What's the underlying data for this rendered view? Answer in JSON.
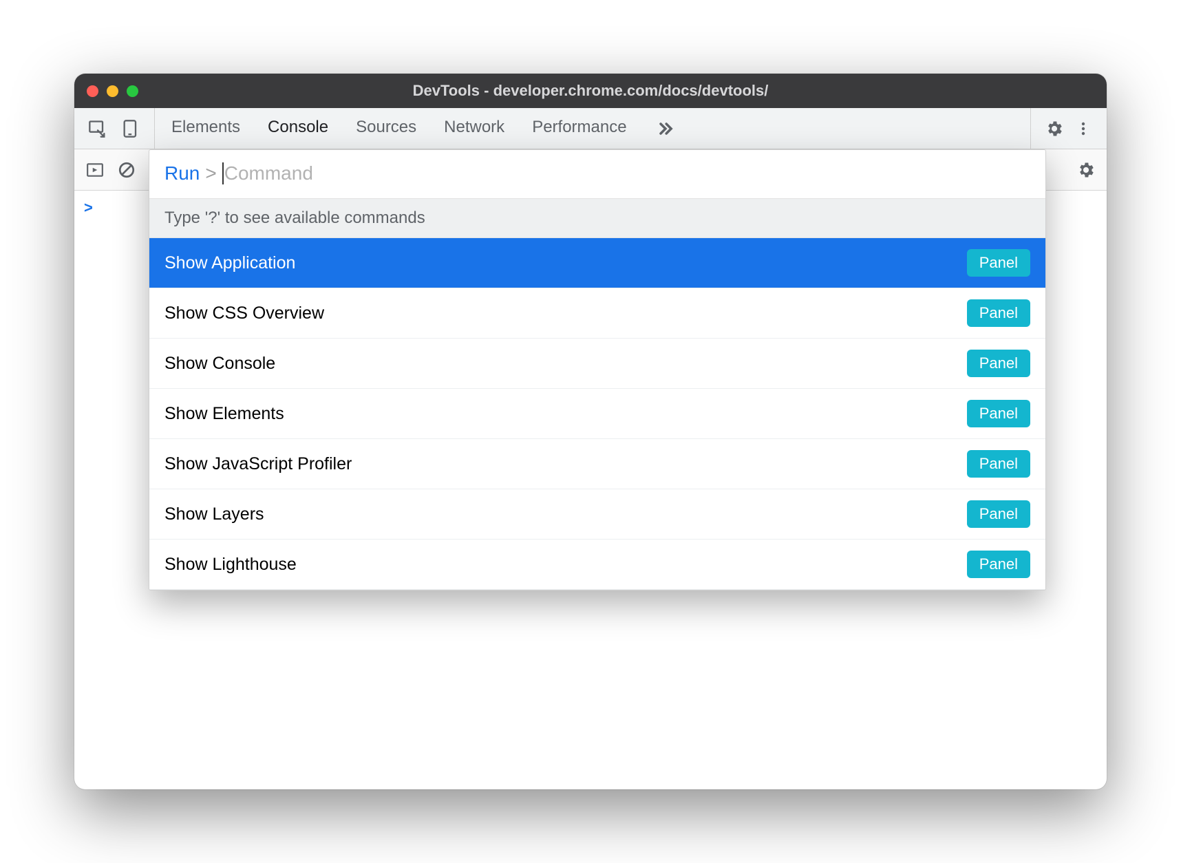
{
  "window": {
    "title": "DevTools - developer.chrome.com/docs/devtools/"
  },
  "tabs": {
    "items": [
      {
        "label": "Elements",
        "active": false
      },
      {
        "label": "Console",
        "active": true
      },
      {
        "label": "Sources",
        "active": false
      },
      {
        "label": "Network",
        "active": false
      },
      {
        "label": "Performance",
        "active": false
      }
    ],
    "overflow_icon": "chevrons-right"
  },
  "command_menu": {
    "prefix": "Run",
    "arrow": ">",
    "placeholder": "Command",
    "hint": "Type '?' to see available commands",
    "items": [
      {
        "label": "Show Application",
        "badge": "Panel",
        "selected": true
      },
      {
        "label": "Show CSS Overview",
        "badge": "Panel",
        "selected": false
      },
      {
        "label": "Show Console",
        "badge": "Panel",
        "selected": false
      },
      {
        "label": "Show Elements",
        "badge": "Panel",
        "selected": false
      },
      {
        "label": "Show JavaScript Profiler",
        "badge": "Panel",
        "selected": false
      },
      {
        "label": "Show Layers",
        "badge": "Panel",
        "selected": false
      },
      {
        "label": "Show Lighthouse",
        "badge": "Panel",
        "selected": false
      }
    ]
  },
  "console": {
    "prompt": ">"
  }
}
